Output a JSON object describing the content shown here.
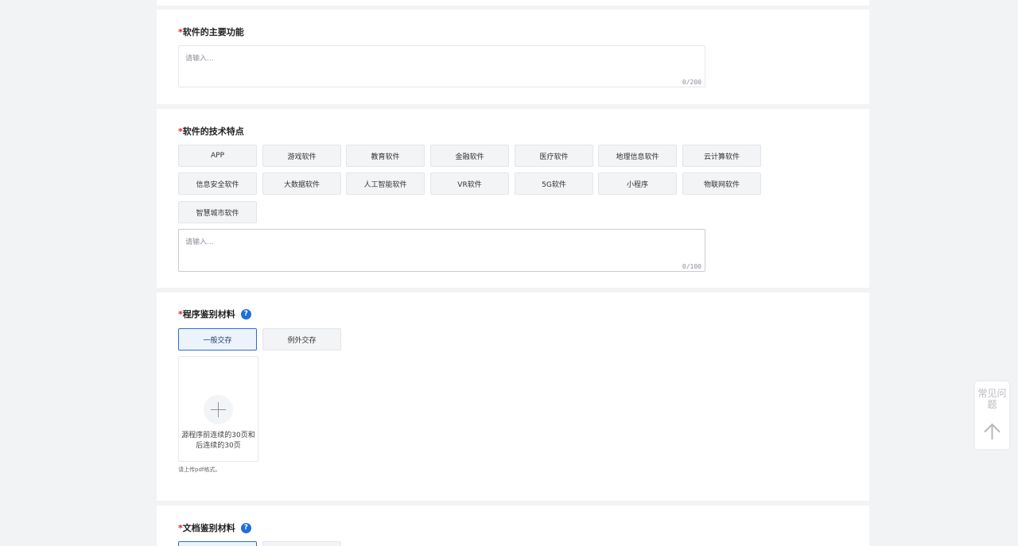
{
  "main_function": {
    "required_mark": "*",
    "title": "软件的主要功能",
    "placeholder": "请输入...",
    "counter": "0/200"
  },
  "tech_features": {
    "required_mark": "*",
    "title": "软件的技术特点",
    "tags": [
      "APP",
      "游戏软件",
      "教育软件",
      "金融软件",
      "医疗软件",
      "地理信息软件",
      "云计算软件",
      "信息安全软件",
      "大数据软件",
      "人工智能软件",
      "VR软件",
      "5G软件",
      "小程序",
      "物联网软件",
      "智慧城市软件"
    ],
    "placeholder": "请输入...",
    "counter": "0/100"
  },
  "program_material": {
    "required_mark": "*",
    "title": "程序鉴别材料",
    "help": "?",
    "options": [
      "一般交存",
      "例外交存"
    ],
    "selected": "一般交存",
    "upload_text": "源程序前连续的30页和后连续的30页",
    "upload_icon": "plus-icon",
    "hint": "请上传pdf格式。"
  },
  "doc_material": {
    "required_mark": "*",
    "title": "文档鉴别材料",
    "help": "?"
  },
  "float_panel": {
    "faq_label": "常见问题",
    "back_to_top_icon": "arrow-up-icon"
  },
  "colors": {
    "accent": "#1e6fd9",
    "required": "#e02020",
    "background": "#f2f3f5"
  }
}
